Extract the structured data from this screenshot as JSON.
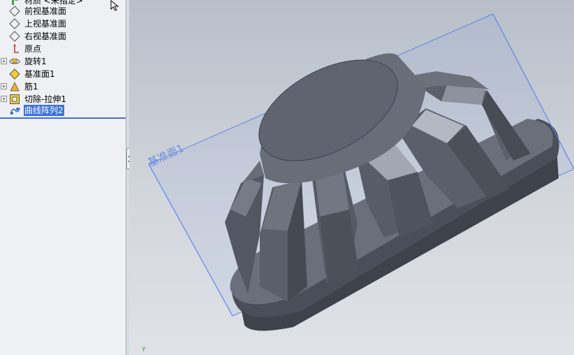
{
  "feature_tree": {
    "items": [
      {
        "label": "材质 <未指定>",
        "icon": "material-icon",
        "expandable": false
      },
      {
        "label": "前视基准面",
        "icon": "plane-icon",
        "expandable": false
      },
      {
        "label": "上视基准面",
        "icon": "plane-icon",
        "expandable": false
      },
      {
        "label": "右视基准面",
        "icon": "plane-icon",
        "expandable": false
      },
      {
        "label": "原点",
        "icon": "origin-icon",
        "expandable": false
      },
      {
        "label": "旋转1",
        "icon": "revolve-icon",
        "expandable": true
      },
      {
        "label": "基准面1",
        "icon": "plane-yellow-icon",
        "expandable": false
      },
      {
        "label": "筋1",
        "icon": "rib-icon",
        "expandable": true
      },
      {
        "label": "切除-拉伸1",
        "icon": "cut-extrude-icon",
        "expandable": true
      },
      {
        "label": "曲线阵列2",
        "icon": "curve-pattern-icon",
        "expandable": false,
        "selected": true
      }
    ]
  },
  "viewport": {
    "plane_label": "基准面1",
    "axis_label": "Y"
  },
  "colors": {
    "selection": "#3b72d8",
    "plane_outline": "#5b86e6",
    "model_face": "#5d626d"
  }
}
